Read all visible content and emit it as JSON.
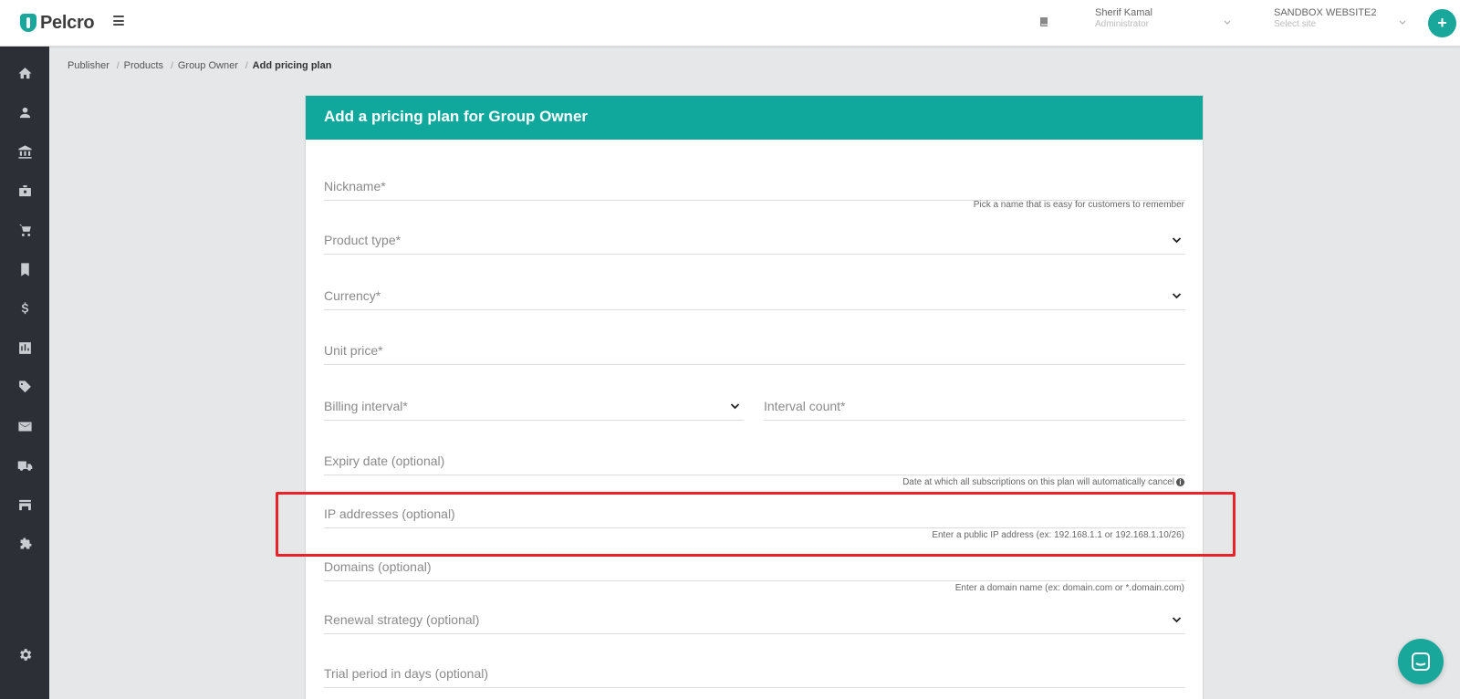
{
  "app": {
    "name": "Pelcro"
  },
  "topbar": {
    "user_name": "Sherif Kamal",
    "user_role": "Administrator",
    "site_name": "SANDBOX WEBSITE2",
    "site_placeholder": "Select site",
    "add_label": "+"
  },
  "sidebar": {
    "items": [
      {
        "icon": "home-icon"
      },
      {
        "icon": "person-icon"
      },
      {
        "icon": "bank-icon"
      },
      {
        "icon": "briefcase-icon"
      },
      {
        "icon": "cart-icon"
      },
      {
        "icon": "bookmark-icon"
      },
      {
        "icon": "dollar-icon"
      },
      {
        "icon": "chart-icon"
      },
      {
        "icon": "tag-icon"
      },
      {
        "icon": "mail-icon"
      },
      {
        "icon": "truck-icon"
      },
      {
        "icon": "store-icon"
      },
      {
        "icon": "puzzle-icon"
      },
      {
        "icon": "gear-icon"
      }
    ]
  },
  "breadcrumb": {
    "items": [
      "Publisher",
      "Products",
      "Group Owner"
    ],
    "separator": "/",
    "current": "Add pricing plan"
  },
  "form": {
    "title": "Add a pricing plan for Group Owner",
    "nickname": {
      "label": "Nickname*",
      "hint": "Pick a name that is easy for customers to remember"
    },
    "product_type": {
      "label": "Product type*"
    },
    "currency": {
      "label": "Currency*"
    },
    "unit_price": {
      "label": "Unit price*"
    },
    "billing_interval": {
      "label": "Billing interval*"
    },
    "interval_count": {
      "label": "Interval count*"
    },
    "expiry_date": {
      "label": "Expiry date (optional)",
      "hint": "Date at which all subscriptions on this plan will automatically cancel"
    },
    "ip_addresses": {
      "label": "IP addresses (optional)",
      "hint": "Enter a public IP address (ex: 192.168.1.1 or 192.168.1.10/26)"
    },
    "domains": {
      "label": "Domains (optional)",
      "hint": "Enter a domain name (ex: domain.com or *.domain.com)"
    },
    "renewal_strategy": {
      "label": "Renewal strategy (optional)"
    },
    "trial_period": {
      "label": "Trial period in days (optional)"
    }
  },
  "colors": {
    "accent": "#10a89d",
    "highlight": "#e8232a",
    "sidebar": "#2c2f35"
  }
}
